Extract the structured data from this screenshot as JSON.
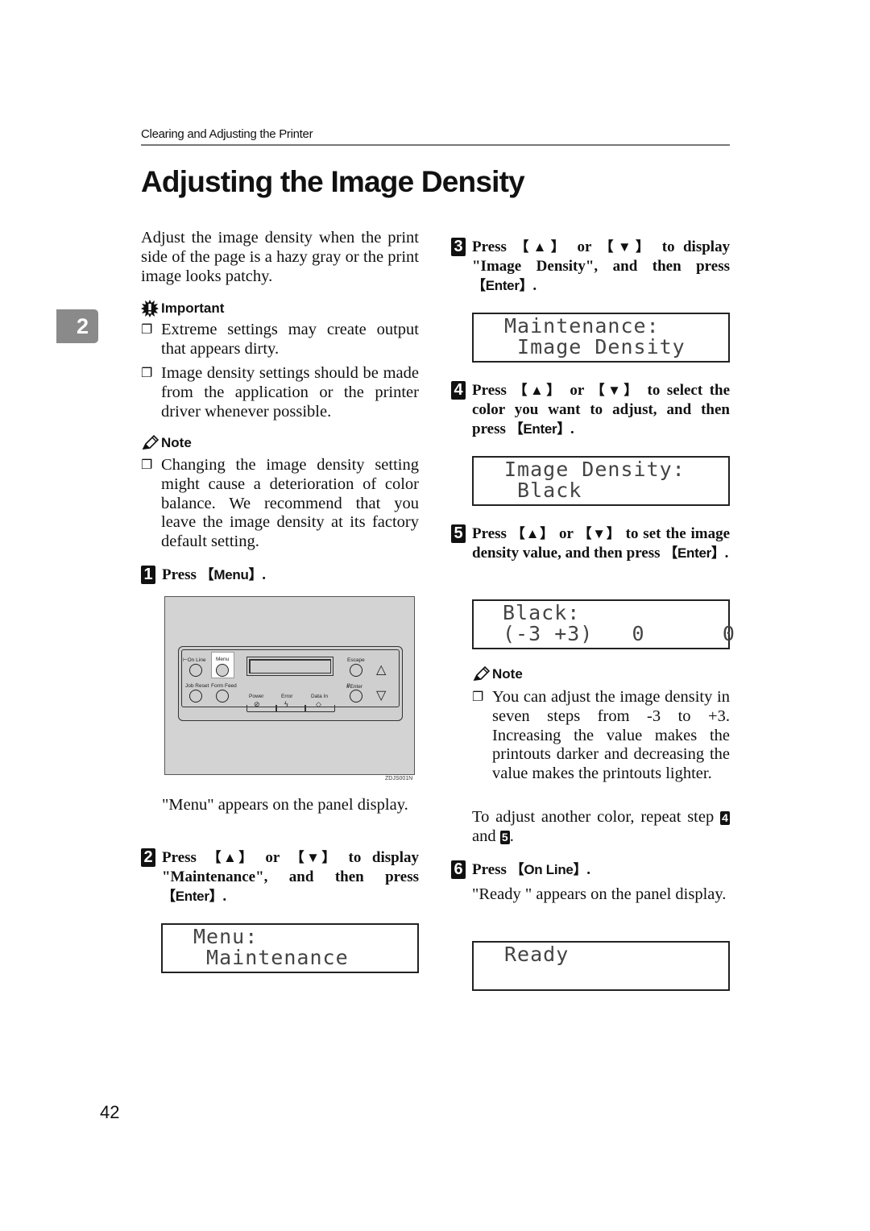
{
  "header": {
    "running_head": "Clearing and Adjusting the Printer",
    "title": "Adjusting the Image Density"
  },
  "chapter_tab": "2",
  "intro": "Adjust the image density when the print side of the page is a hazy gray or the print image looks patchy.",
  "important": {
    "icon": "important-burst-icon",
    "label": "Important",
    "items": [
      "Extreme settings may create output that appears dirty.",
      "Image density settings should be made from the application or the printer driver whenever possible."
    ]
  },
  "note1": {
    "icon": "pencil-note-icon",
    "label": "Note",
    "items": [
      "Changing the image density setting might cause a deterioration of color balance. We recommend that you leave the image density at its factory default setting."
    ]
  },
  "checkbox_glyph": "❐",
  "keys": {
    "menu": "Menu",
    "up": "▲",
    "down": "▼",
    "enter": "Enter",
    "en": "En-",
    "ter": "ter",
    "on_line": "On Line",
    "open": "【",
    "close": "】"
  },
  "steps": [
    {
      "num": "1",
      "pre": "Press ",
      "key": "Menu",
      "post": ".",
      "after_text": "\"Menu\" appears on the panel display."
    },
    {
      "num": "2",
      "text_a": "Press ",
      "text_b": " or ",
      "text_c": " to display \"Maintenance\", and then press ",
      "text_d": ".",
      "lcd": [
        "Menu:",
        " Maintenance"
      ]
    },
    {
      "num": "3",
      "text_a": "Press ",
      "text_b": " or ",
      "text_c": " to display \"Image Density\", and then press ",
      "text_d": ".",
      "lcd": [
        "Maintenance:",
        " Image Density"
      ]
    },
    {
      "num": "4",
      "text_a": "Press ",
      "text_b": " or ",
      "text_c": " to select the color you want to adjust, and then press ",
      "text_d": ".",
      "lcd": [
        "Image Density:",
        " Black"
      ]
    },
    {
      "num": "5",
      "text_a": "Press ",
      "text_b": " or ",
      "text_c": " to set the image density value, and then press ",
      "text_d": ".",
      "lcd": [
        "Black:",
        "(-3 +3)   0      0"
      ]
    },
    {
      "num": "6",
      "pre": "Press ",
      "key": "On Line",
      "post": ".",
      "after_text": "\"Ready \" appears on the panel display.",
      "lcd": [
        "Ready",
        ""
      ]
    }
  ],
  "note2": {
    "icon": "pencil-note-icon",
    "label": "Note",
    "items": [
      "You can adjust the image density in seven steps from -3 to +3. Increasing the value makes the printouts darker and decreasing the value makes the printouts lighter."
    ],
    "repeat_text_a": "To adjust another color, repeat step ",
    "repeat_step_a": "4",
    "repeat_and": " and ",
    "repeat_step_b": "5",
    "repeat_end": "."
  },
  "panel_figure": {
    "labels": {
      "on_line": "On Line",
      "menu": "Menu",
      "escape": "Escape",
      "job_reset": "Job Reset",
      "form_feed": "Form Feed",
      "enter": "Enter",
      "power": "Power",
      "error": "Error",
      "data_in": "Data In"
    },
    "code": "ZDJS001N"
  },
  "page_number": "42"
}
